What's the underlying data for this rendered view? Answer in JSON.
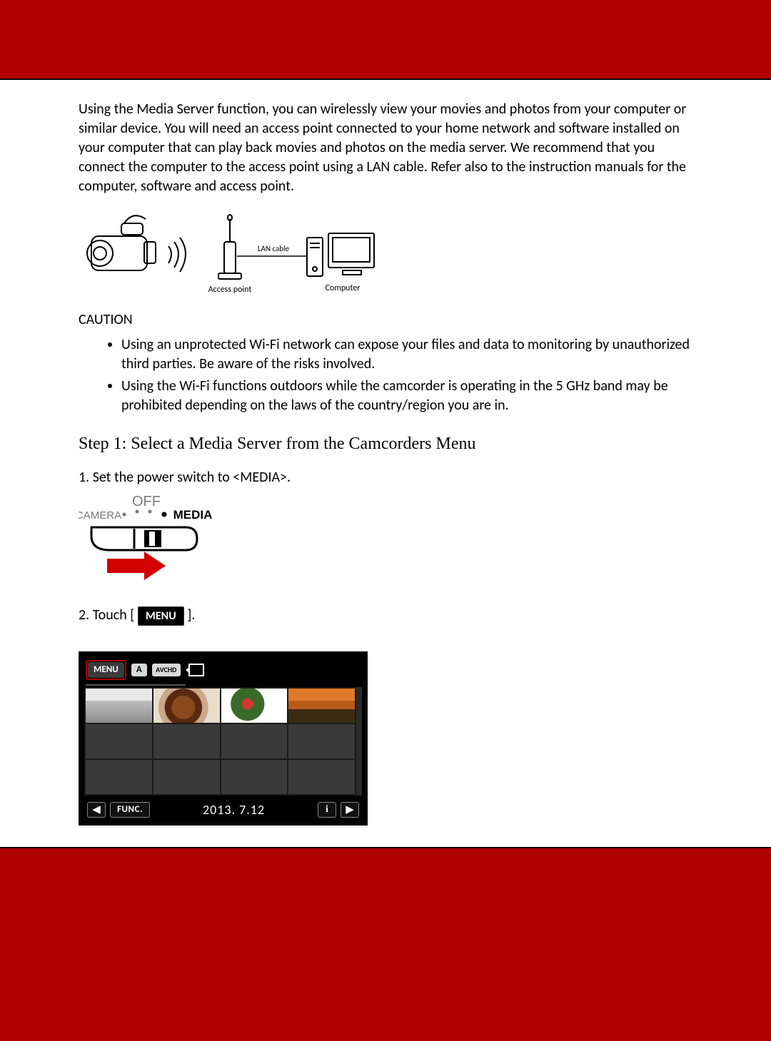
{
  "intro": "Using the Media Server function, you can wirelessly view your movies and photos from your computer or similar device. You will need an access point connected to your home network and software installed on your computer that can play back movies and photos on the media server. We recommend that you connect the computer to the access point using a LAN cable. Refer also to the instruction manuals for the computer, software and access point.",
  "diagram": {
    "lan_label": "LAN cable",
    "ap_label": "Access point",
    "pc_label": "Computer"
  },
  "caution_heading": "CAUTION",
  "caution_items": [
    "Using an unprotected Wi-Fi network can expose your files and data to monitoring by unauthorized third parties. Be aware of the risks involved.",
    "Using the Wi-Fi functions outdoors while the camcorder is operating in the 5 GHz band may be prohibited depending on the laws of the country/region you are in."
  ],
  "step1_heading": "Step 1: Select a Media Server from the Camcorders Menu",
  "step1_item1": "1. Set the power switch to <MEDIA>.",
  "switch": {
    "off": "OFF",
    "camera": "CAMERA",
    "media": "MEDIA"
  },
  "step1_item2_prefix": "2. Touch [",
  "step1_item2_suffix": "].",
  "menu_label": "MENU",
  "lcd": {
    "menu": "MENU",
    "a": "A",
    "avchd": "AVCHD",
    "func": "FUNC.",
    "date": "2013. 7.12",
    "info": "i",
    "left": "◀",
    "right": "▶"
  }
}
